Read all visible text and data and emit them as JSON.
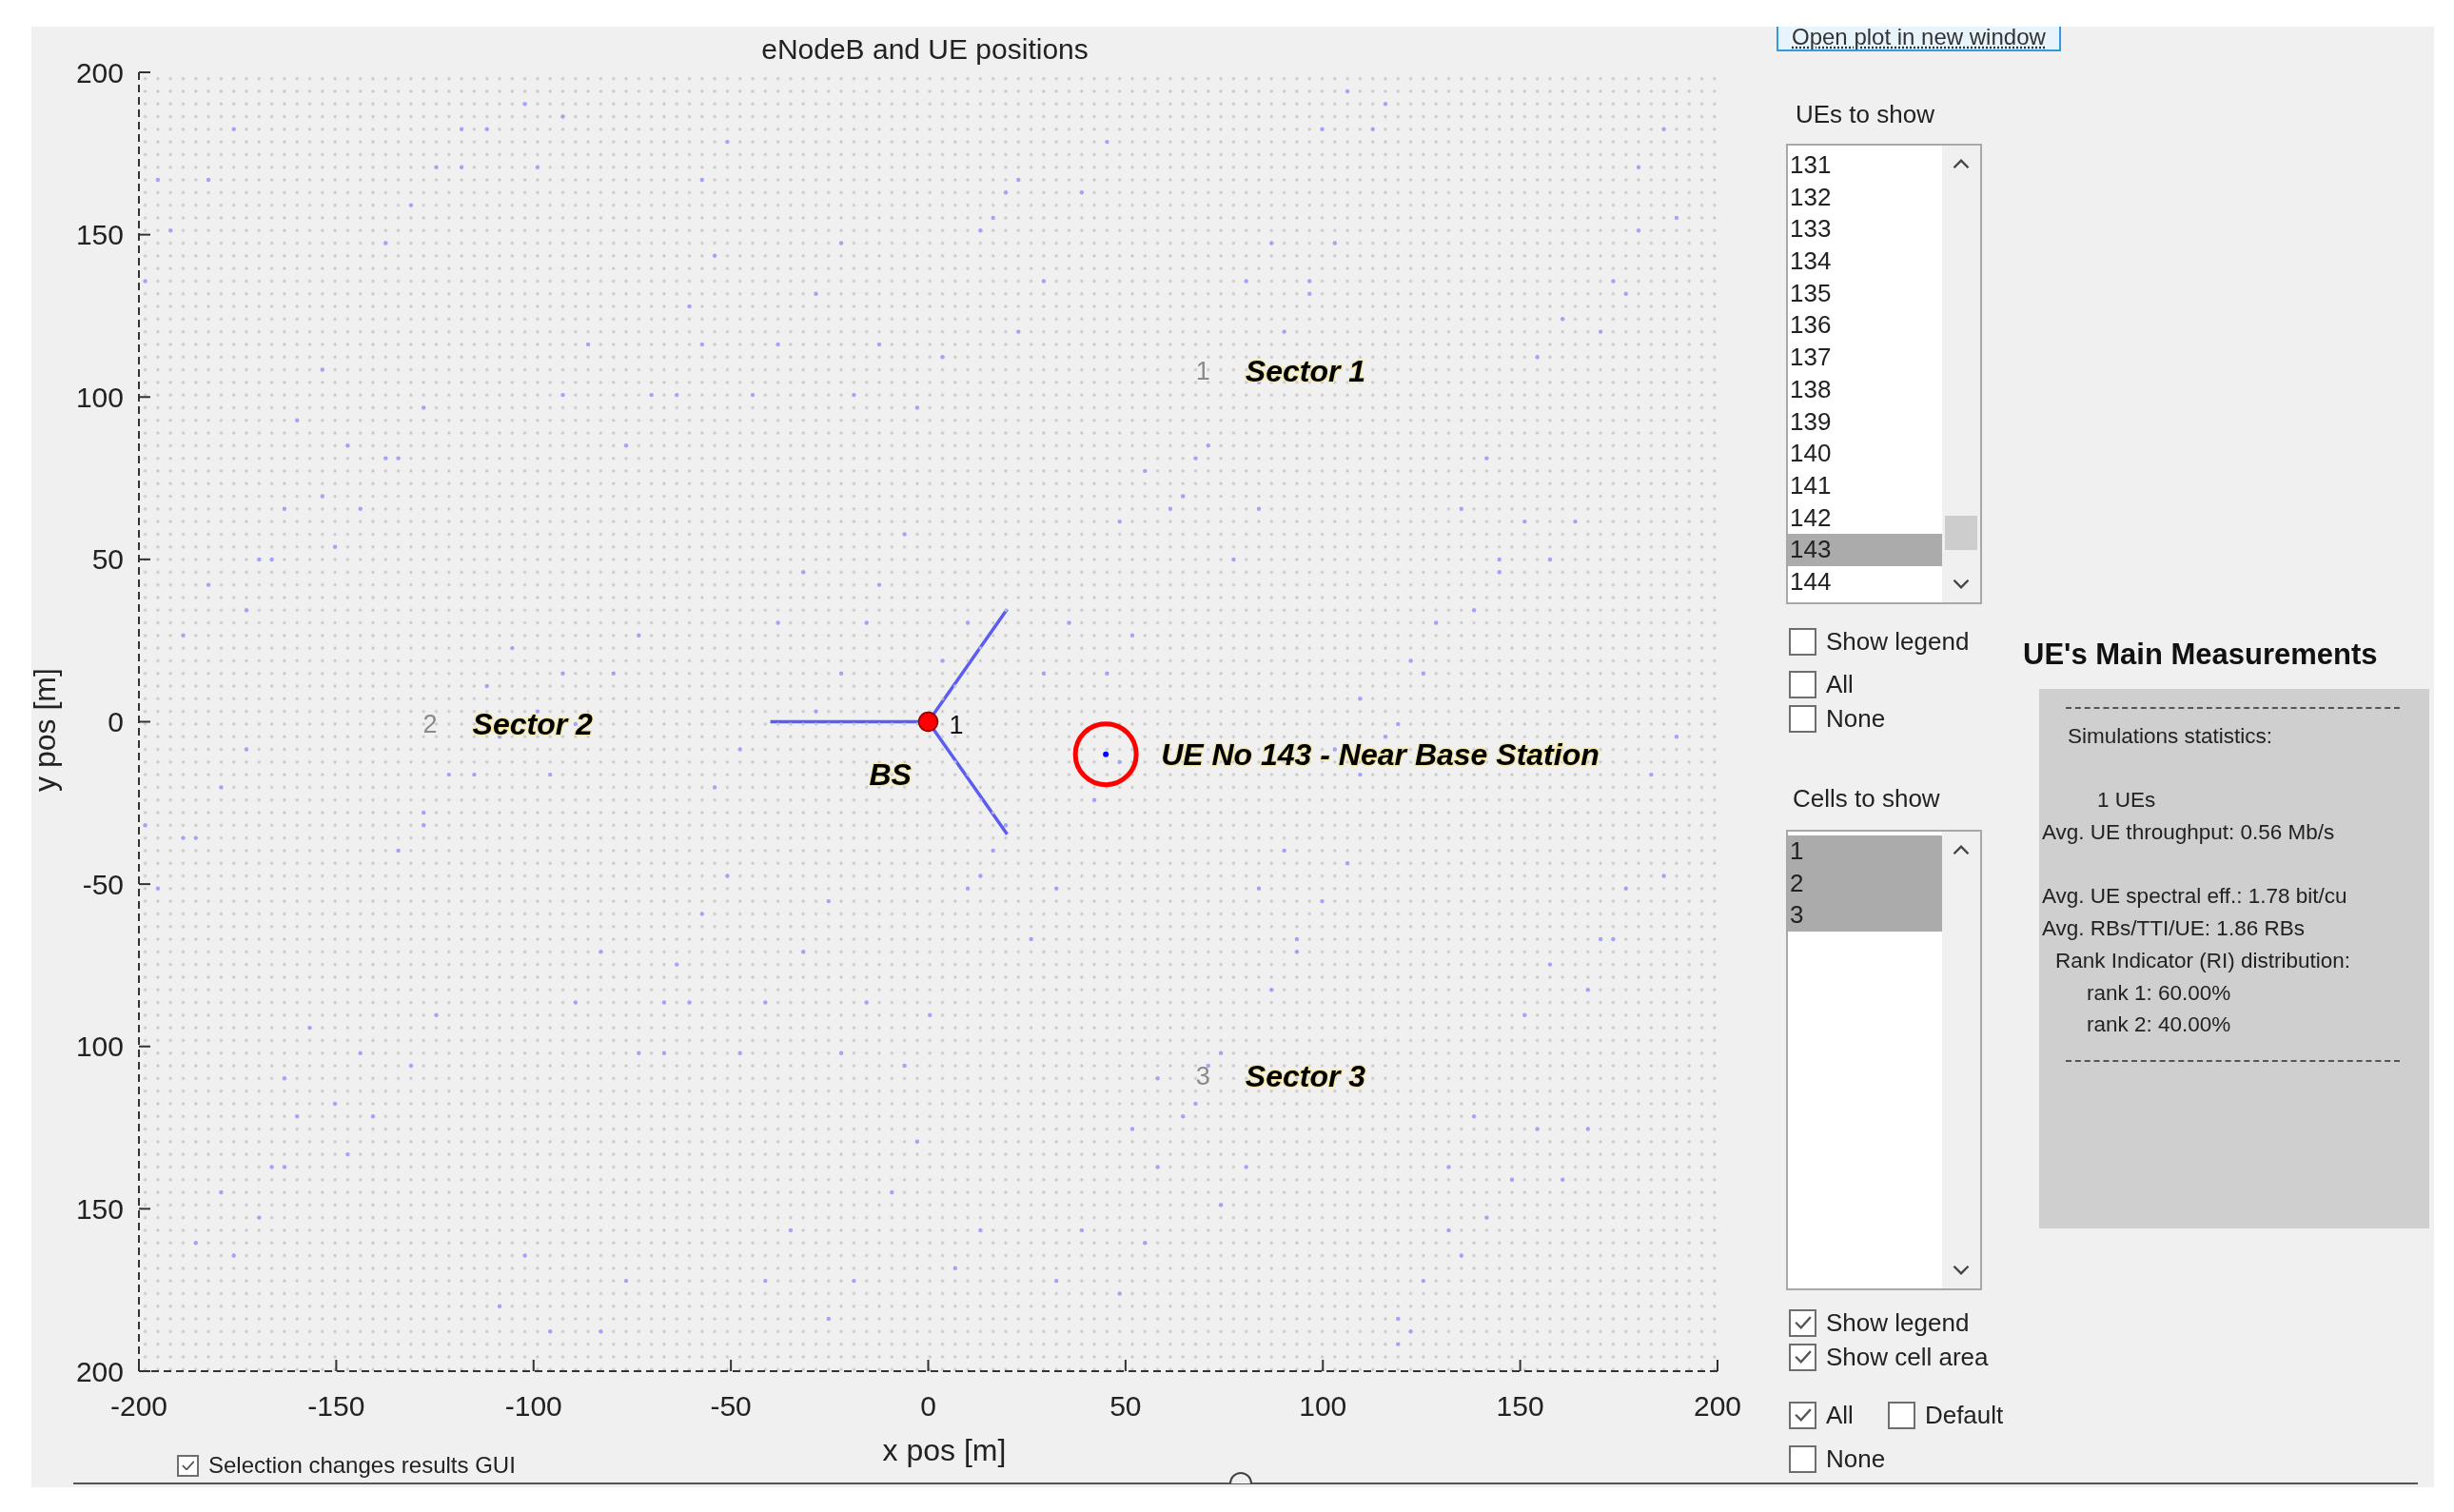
{
  "plot": {
    "chart_data": {
      "type": "scatter",
      "title": "eNodeB and UE positions",
      "xlabel": "x pos [m]",
      "ylabel": "y pos [m]",
      "x": [
        0,
        45
      ],
      "series": [
        {
          "color": "#ff0000",
          "values": [
            0,
            null
          ]
        },
        {
          "color": "#0000ff",
          "values": [
            null,
            -10
          ]
        }
      ],
      "xlim": [
        -200,
        200
      ],
      "ylim": [
        -200,
        200
      ],
      "xticks": [
        -200,
        -150,
        -100,
        -50,
        0,
        50,
        100,
        150,
        200
      ],
      "yticks": [
        {
          "value": -200,
          "label": "200"
        },
        {
          "value": -150,
          "label": "150"
        },
        {
          "value": -100,
          "label": "100"
        },
        -50,
        0,
        50,
        100,
        150,
        200
      ],
      "annotations": [
        {
          "text": "UE No 143 - Near Base Station",
          "x": 45,
          "y": -10
        }
      ]
    },
    "base_station": {
      "label": "BS",
      "number": "1"
    },
    "sectors": [
      {
        "number": "1",
        "label": "Sector 1"
      },
      {
        "number": "2",
        "label": "Sector 2"
      },
      {
        "number": "3",
        "label": "Sector 3"
      }
    ]
  },
  "selection_checkbox": {
    "label": "Selection changes results GUI",
    "checked": true
  },
  "open_plot_link": "Open plot in new window",
  "ue_panel": {
    "label": "UEs to show",
    "items": [
      {
        "label": "131",
        "selected": false
      },
      {
        "label": "132",
        "selected": false
      },
      {
        "label": "133",
        "selected": false
      },
      {
        "label": "134",
        "selected": false
      },
      {
        "label": "135",
        "selected": false
      },
      {
        "label": "136",
        "selected": false
      },
      {
        "label": "137",
        "selected": false
      },
      {
        "label": "138",
        "selected": false
      },
      {
        "label": "139",
        "selected": false
      },
      {
        "label": "140",
        "selected": false
      },
      {
        "label": "141",
        "selected": false
      },
      {
        "label": "142",
        "selected": false
      },
      {
        "label": "143",
        "selected": true
      },
      {
        "label": "144",
        "selected": false
      }
    ],
    "checkbox_rows": [
      [
        {
          "label": "Show legend",
          "checked": false
        }
      ],
      [
        {
          "label": "All",
          "checked": false
        }
      ],
      [
        {
          "label": "None",
          "checked": false
        }
      ]
    ]
  },
  "cells_panel": {
    "label": "Cells to show",
    "items": [
      {
        "label": "1",
        "selected": true
      },
      {
        "label": "2",
        "selected": true
      },
      {
        "label": "3",
        "selected": true
      }
    ],
    "checkbox_rows": [
      [
        {
          "label": "Show legend",
          "checked": true
        }
      ],
      [
        {
          "label": "Show cell area",
          "checked": true
        }
      ],
      [
        {
          "label": "All",
          "checked": true
        },
        {
          "label": "Default",
          "checked": false
        }
      ],
      [
        {
          "label": "None",
          "checked": false
        }
      ]
    ]
  },
  "measurements": {
    "title": "UE's Main Measurements",
    "groups": [
      [
        {
          "kind": "heading",
          "text": "Simulations statistics:"
        }
      ],
      [
        {
          "kind": "count",
          "text": "1 UEs"
        },
        {
          "kind": "stat",
          "text": "Avg. UE throughput: 0.56 Mb/s"
        }
      ],
      [
        {
          "kind": "stat",
          "text": "Avg. UE spectral eff.: 1.78 bit/cu"
        },
        {
          "kind": "stat",
          "text": "Avg. RBs/TTI/UE: 1.86 RBs"
        },
        {
          "kind": "subheading",
          "text": "Rank Indicator (RI) distribution:"
        },
        {
          "kind": "item",
          "text": "rank 1: 60.00%"
        },
        {
          "kind": "item",
          "text": "rank 2: 40.00%"
        }
      ]
    ]
  }
}
